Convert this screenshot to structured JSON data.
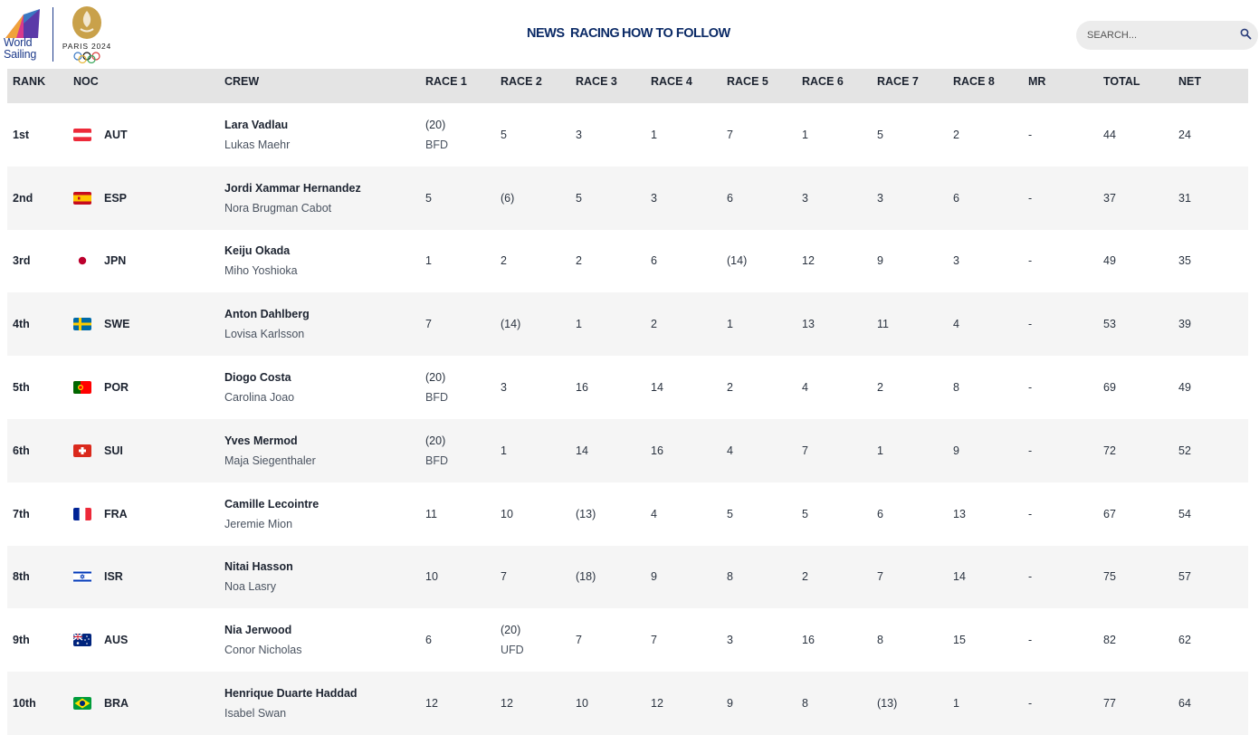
{
  "header": {
    "brand": {
      "world_sailing": "World\nSailing",
      "paris_text": "PARIS 2024"
    },
    "nav": [
      {
        "label": "NEWS"
      },
      {
        "label": "RACING"
      },
      {
        "label": "HOW TO FOLLOW"
      }
    ],
    "search": {
      "placeholder": "SEARCH..."
    }
  },
  "table": {
    "columns": [
      "RANK",
      "NOC",
      "CREW",
      "RACE 1",
      "RACE 2",
      "RACE 3",
      "RACE 4",
      "RACE 5",
      "RACE 6",
      "RACE 7",
      "RACE 8",
      "MR",
      "TOTAL",
      "NET"
    ],
    "rows": [
      {
        "rank": "1st",
        "flag": "aut",
        "noc": "AUT",
        "crew": [
          "Lara Vadlau",
          "Lukas Maehr"
        ],
        "races": [
          [
            "(20)",
            "BFD"
          ],
          [
            "5"
          ],
          [
            "3"
          ],
          [
            "1"
          ],
          [
            "7"
          ],
          [
            "1"
          ],
          [
            "5"
          ],
          [
            "2"
          ]
        ],
        "mr": "-",
        "total": "44",
        "net": "24"
      },
      {
        "rank": "2nd",
        "flag": "esp",
        "noc": "ESP",
        "crew": [
          "Jordi Xammar Hernandez",
          "Nora Brugman Cabot"
        ],
        "races": [
          [
            "5"
          ],
          [
            "(6)"
          ],
          [
            "5"
          ],
          [
            "3"
          ],
          [
            "6"
          ],
          [
            "3"
          ],
          [
            "3"
          ],
          [
            "6"
          ]
        ],
        "mr": "-",
        "total": "37",
        "net": "31"
      },
      {
        "rank": "3rd",
        "flag": "jpn",
        "noc": "JPN",
        "crew": [
          "Keiju Okada",
          "Miho Yoshioka"
        ],
        "races": [
          [
            "1"
          ],
          [
            "2"
          ],
          [
            "2"
          ],
          [
            "6"
          ],
          [
            "(14)"
          ],
          [
            "12"
          ],
          [
            "9"
          ],
          [
            "3"
          ]
        ],
        "mr": "-",
        "total": "49",
        "net": "35"
      },
      {
        "rank": "4th",
        "flag": "swe",
        "noc": "SWE",
        "crew": [
          "Anton Dahlberg",
          "Lovisa Karlsson"
        ],
        "races": [
          [
            "7"
          ],
          [
            "(14)"
          ],
          [
            "1"
          ],
          [
            "2"
          ],
          [
            "1"
          ],
          [
            "13"
          ],
          [
            "11"
          ],
          [
            "4"
          ]
        ],
        "mr": "-",
        "total": "53",
        "net": "39"
      },
      {
        "rank": "5th",
        "flag": "por",
        "noc": "POR",
        "crew": [
          "Diogo Costa",
          "Carolina Joao"
        ],
        "races": [
          [
            "(20)",
            "BFD"
          ],
          [
            "3"
          ],
          [
            "16"
          ],
          [
            "14"
          ],
          [
            "2"
          ],
          [
            "4"
          ],
          [
            "2"
          ],
          [
            "8"
          ]
        ],
        "mr": "-",
        "total": "69",
        "net": "49"
      },
      {
        "rank": "6th",
        "flag": "sui",
        "noc": "SUI",
        "crew": [
          "Yves Mermod",
          "Maja Siegenthaler"
        ],
        "races": [
          [
            "(20)",
            "BFD"
          ],
          [
            "1"
          ],
          [
            "14"
          ],
          [
            "16"
          ],
          [
            "4"
          ],
          [
            "7"
          ],
          [
            "1"
          ],
          [
            "9"
          ]
        ],
        "mr": "-",
        "total": "72",
        "net": "52"
      },
      {
        "rank": "7th",
        "flag": "fra",
        "noc": "FRA",
        "crew": [
          "Camille Lecointre",
          "Jeremie Mion"
        ],
        "races": [
          [
            "11"
          ],
          [
            "10"
          ],
          [
            "(13)"
          ],
          [
            "4"
          ],
          [
            "5"
          ],
          [
            "5"
          ],
          [
            "6"
          ],
          [
            "13"
          ]
        ],
        "mr": "-",
        "total": "67",
        "net": "54"
      },
      {
        "rank": "8th",
        "flag": "isr",
        "noc": "ISR",
        "crew": [
          "Nitai Hasson",
          "Noa Lasry"
        ],
        "races": [
          [
            "10"
          ],
          [
            "7"
          ],
          [
            "(18)"
          ],
          [
            "9"
          ],
          [
            "8"
          ],
          [
            "2"
          ],
          [
            "7"
          ],
          [
            "14"
          ]
        ],
        "mr": "-",
        "total": "75",
        "net": "57"
      },
      {
        "rank": "9th",
        "flag": "aus",
        "noc": "AUS",
        "crew": [
          "Nia Jerwood",
          "Conor Nicholas"
        ],
        "races": [
          [
            "6"
          ],
          [
            "(20)",
            "UFD"
          ],
          [
            "7"
          ],
          [
            "7"
          ],
          [
            "3"
          ],
          [
            "16"
          ],
          [
            "8"
          ],
          [
            "15"
          ]
        ],
        "mr": "-",
        "total": "82",
        "net": "62"
      },
      {
        "rank": "10th",
        "flag": "bra",
        "noc": "BRA",
        "crew": [
          "Henrique Duarte Haddad",
          "Isabel Swan"
        ],
        "races": [
          [
            "12"
          ],
          [
            "12"
          ],
          [
            "10"
          ],
          [
            "12"
          ],
          [
            "9"
          ],
          [
            "8"
          ],
          [
            "(13)"
          ],
          [
            "1"
          ]
        ],
        "mr": "-",
        "total": "77",
        "net": "64"
      }
    ]
  },
  "colors": {
    "nav_text": "#0b2a66",
    "header_row_bg": "#e4e4e4",
    "alt_row_bg": "#f5f5f5",
    "search_bg": "#ececec"
  },
  "icons": {
    "search": "search-icon",
    "flags": [
      "flag-aut-icon",
      "flag-esp-icon",
      "flag-jpn-icon",
      "flag-swe-icon",
      "flag-por-icon",
      "flag-sui-icon",
      "flag-fra-icon",
      "flag-isr-icon",
      "flag-aus-icon",
      "flag-bra-icon"
    ]
  }
}
